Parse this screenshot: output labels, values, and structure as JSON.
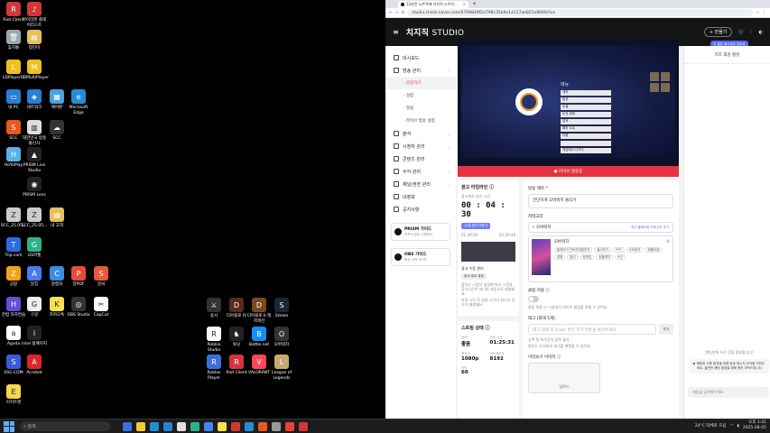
{
  "desktop": {
    "icons": [
      {
        "label": "Riot Client",
        "color": "#d13639",
        "glyph": "R"
      },
      {
        "label": "마이리본 플레이리스트",
        "color": "#d13639",
        "glyph": "♪"
      },
      {
        "label": "휴지통",
        "color": "#9aa",
        "glyph": "🗑"
      },
      {
        "label": "정진이",
        "color": "#e8c05a",
        "glyph": "▤"
      },
      {
        "label": "LDPlayer 9",
        "color": "#f0c020",
        "glyph": "L"
      },
      {
        "label": "LDMultiPlayer",
        "color": "#f0c020",
        "glyph": "M"
      },
      {
        "label": "내 PC",
        "color": "#2a7fd4",
        "glyph": "▭"
      },
      {
        "label": "네트워크",
        "color": "#2a7fd4",
        "glyph": "◈"
      },
      {
        "label": "제어판",
        "color": "#4aa3df",
        "glyph": "▦"
      },
      {
        "label": "Microsoft Edge",
        "color": "#1f8fd6",
        "glyph": "e"
      },
      {
        "label": "SCC",
        "color": "#e65a1c",
        "glyph": "S"
      },
      {
        "label": "대한민국 방송 통신사",
        "color": "#ddd",
        "glyph": "▥"
      },
      {
        "label": "SCC",
        "color": "#333",
        "glyph": "☁"
      },
      {
        "label": "HoYoPlay",
        "color": "#5ab0e8",
        "glyph": "H"
      },
      {
        "label": "PRISM Live Studio",
        "color": "#222",
        "glyph": "▲"
      },
      {
        "label": "PRISM Lens",
        "color": "#222",
        "glyph": "◉"
      },
      {
        "label": "SCC_25.05...",
        "color": "#ccc",
        "glyph": "Z"
      },
      {
        "label": "SCC_25.05...",
        "color": "#ccc",
        "glyph": "Z"
      },
      {
        "label": "내 고객",
        "color": "#e8c05a",
        "glyph": "▤"
      },
      {
        "label": "Trip.com",
        "color": "#2a6de0",
        "glyph": "T"
      },
      {
        "label": "GS마켓",
        "color": "#2ab48a",
        "glyph": "G"
      },
      {
        "label": "곰팡",
        "color": "#f3a21c",
        "glyph": "Z"
      },
      {
        "label": "알집",
        "color": "#4c7be8",
        "glyph": "A"
      },
      {
        "label": "알캡처",
        "color": "#3c8fe0",
        "glyph": "C"
      },
      {
        "label": "알PDF",
        "color": "#e54b3c",
        "glyph": "P"
      },
      {
        "label": "알씨",
        "color": "#e55a3c",
        "glyph": "S"
      },
      {
        "label": "한컴 타자연습",
        "color": "#6a4bd6",
        "glyph": "H"
      },
      {
        "label": "구글",
        "color": "#eee",
        "glyph": "G"
      },
      {
        "label": "카카오톡",
        "color": "#f7e14c",
        "glyph": "K"
      },
      {
        "label": "OBS Studio",
        "color": "#333",
        "glyph": "◎"
      },
      {
        "label": "CapCut",
        "color": "#fff",
        "glyph": "✂"
      },
      {
        "label": "Agoda",
        "color": "#fff",
        "glyph": "a"
      },
      {
        "label": "Intel 홈페이지",
        "color": "#222",
        "glyph": "i"
      },
      {
        "label": "SSG.COM",
        "color": "#3a5bd9",
        "glyph": "S"
      },
      {
        "label": "Acrobat",
        "color": "#d8262c",
        "glyph": "A"
      },
      {
        "label": "이지트랜",
        "color": "#f5d64c",
        "glyph": "E"
      },
      {
        "label": "용사",
        "color": "#333",
        "glyph": "⚔"
      },
      {
        "label": "디아블로 IV",
        "color": "#5a2a1c",
        "glyph": "D"
      },
      {
        "label": "디아블로 II 레저렉션",
        "color": "#7a4a1c",
        "glyph": "D"
      },
      {
        "label": "Steam",
        "color": "#1b2838",
        "glyph": "S"
      },
      {
        "label": "Roblox Studio",
        "color": "#fff",
        "glyph": "R"
      },
      {
        "label": "튜닝",
        "color": "#222",
        "glyph": "♞"
      },
      {
        "label": "Battle.net",
        "color": "#148eff",
        "glyph": "B"
      },
      {
        "label": "오버워치",
        "color": "#333",
        "glyph": "O"
      },
      {
        "label": "Roblox Player",
        "color": "#3a6fe0",
        "glyph": "R"
      },
      {
        "label": "Riot Client",
        "color": "#d13639",
        "glyph": "R"
      },
      {
        "label": "VALORANT",
        "color": "#ff4655",
        "glyph": "V"
      },
      {
        "label": "League of Legends",
        "color": "#c8aa6e",
        "glyph": "L"
      }
    ]
  },
  "taskbar": {
    "search_placeholder": "검색",
    "weather": "24°C 대체로 흐림",
    "time": "오후 1:41",
    "date": "2025-08-05",
    "app_colors": [
      "#3a6fe0",
      "#f7c934",
      "#1f8fd6",
      "#2a7fd4",
      "#e0e0e0",
      "#2ab48a",
      "#4285f4",
      "#f7e14c",
      "#d13639",
      "#1f8fd6",
      "#e65a1c",
      "#999",
      "#ea4335",
      "#d13639"
    ]
  },
  "browser": {
    "tab_title": "12분전 노트북에 치지직 스트리...",
    "new_tab": "+",
    "url": "studio.chzzk.naver.com/6709849f2a798c35b9e14117ae821e8066/live",
    "icons": [
      "back-icon",
      "forward-icon",
      "reload-icon",
      "star-icon",
      "menu-dots-icon"
    ]
  },
  "studio": {
    "logo_chzzk": "치지직",
    "logo_studio": "STUDIO",
    "create_label": "+ 만들기",
    "toast": "이 결은 메시지가 있어요",
    "nav": [
      {
        "label": "대시보드",
        "icon": "dashboard-icon"
      },
      {
        "label": "방송 관리",
        "icon": "broadcast-icon",
        "expand": "⌃"
      },
      {
        "label": "· 방송하기",
        "sub": true,
        "active": true
      },
      {
        "label": "· 설정",
        "sub": true
      },
      {
        "label": "· 알림",
        "sub": true
      },
      {
        "label": "· 라이브 방송 설정",
        "sub": true
      },
      {
        "label": "분석",
        "icon": "analytics-icon",
        "expand": "⌄"
      },
      {
        "label": "시청자 관리",
        "icon": "viewers-icon",
        "expand": "⌄"
      },
      {
        "label": "콘텐츠 관리",
        "icon": "content-icon",
        "expand": "⌄"
      },
      {
        "label": "수익 관리",
        "icon": "revenue-icon",
        "expand": "⌄"
      },
      {
        "label": "채널/권한 관리",
        "icon": "channel-icon",
        "expand": "⌄"
      },
      {
        "label": "내정보",
        "icon": "profile-icon"
      },
      {
        "label": "공지사항",
        "icon": "notice-icon"
      }
    ],
    "promos": [
      {
        "title": "PRISM 가이드",
        "sub": "치지직 방송 시작하기"
      },
      {
        "title": "OBS 가이드",
        "sub": "방송 시작 가이드"
      }
    ],
    "player": {
      "menu_title": "메뉴",
      "menu_items": [
        "계속",
        "옵션",
        "소셜",
        "도전 과제",
        "업적",
        "패치 노트",
        "지원",
        "",
        "게임에서 나가기"
      ],
      "end_button": "● 라이브 방송중"
    },
    "ad_card": {
      "title": "광고 타임라인 ⓘ",
      "next_label": "광고까지 남은 시간",
      "timer": "00 : 04 : 30",
      "button": "10분 광고 미루기",
      "t1": "01:29:38",
      "t2": "01:29:48",
      "manual_title": "광고 수동 관리",
      "manual_button": "광고 바로 재생",
      "notes": [
        "광고는 시청자 설정에 따라 소정의 휴식시간이 지나면 자동으로 재생돼요.",
        "방송 시작 후 일정 시간이 지나야 광고가 재생돼요."
      ]
    },
    "stream_card": {
      "title": "스트림 상태 ⓘ",
      "stats": [
        {
          "k": "상태",
          "v": "좋음"
        },
        {
          "k": "방송 시간",
          "v": "01:25:31"
        },
        {
          "k": "해상도",
          "v": "1080p"
        },
        {
          "k": "비트레이트",
          "v": "8192"
        },
        {
          "k": "FPS",
          "v": "60"
        }
      ]
    },
    "form": {
      "title_label": "방송 제목 *",
      "title_value": "간단하게 오버워치 돌리기",
      "category_label": "카테고리",
      "category_search": "오버워치",
      "category_add": "최근 플레이한 카테고리 추가",
      "category_name": "오버워치",
      "tags": [
        "플레이어 칸바칸팀챌린지",
        "돌아보기",
        "FPS",
        "오버워치",
        "배틀로얄",
        "경쟁",
        "멀티",
        "팀게임",
        "팀플레이",
        "6인"
      ],
      "clip_label": "클립 허용 ⓘ",
      "clip_note": "클립 허용 시 시청자가 라이브 클립을 만들 수 있어요.",
      "tags_label": "태그 (최대 5개)",
      "tags_placeholder": "태그 입력 후 Enter 혹은 추가 버튼을 눌러주세요",
      "tags_add": "추가",
      "tag_notes": [
        "공백 및 특수문자 입력 불가",
        "원하는 순서대로 태그를 배열할 수 있어요."
      ],
      "thumb_label": "미리보기 이미지 ⓘ",
      "thumb_button": "업로드"
    },
    "chat": {
      "tabs": "치즈 후원 랭킹",
      "empty": "채팅방에 오신 것을 환영합니다!",
      "notice": "채팅방 사용 환경을 위해 방송 메시지 규칙을 지켜주세요. 클린한 채팅 환경을 위해 협조 부탁드립니다.",
      "input_placeholder": "채팅을 입력해주세요"
    }
  }
}
